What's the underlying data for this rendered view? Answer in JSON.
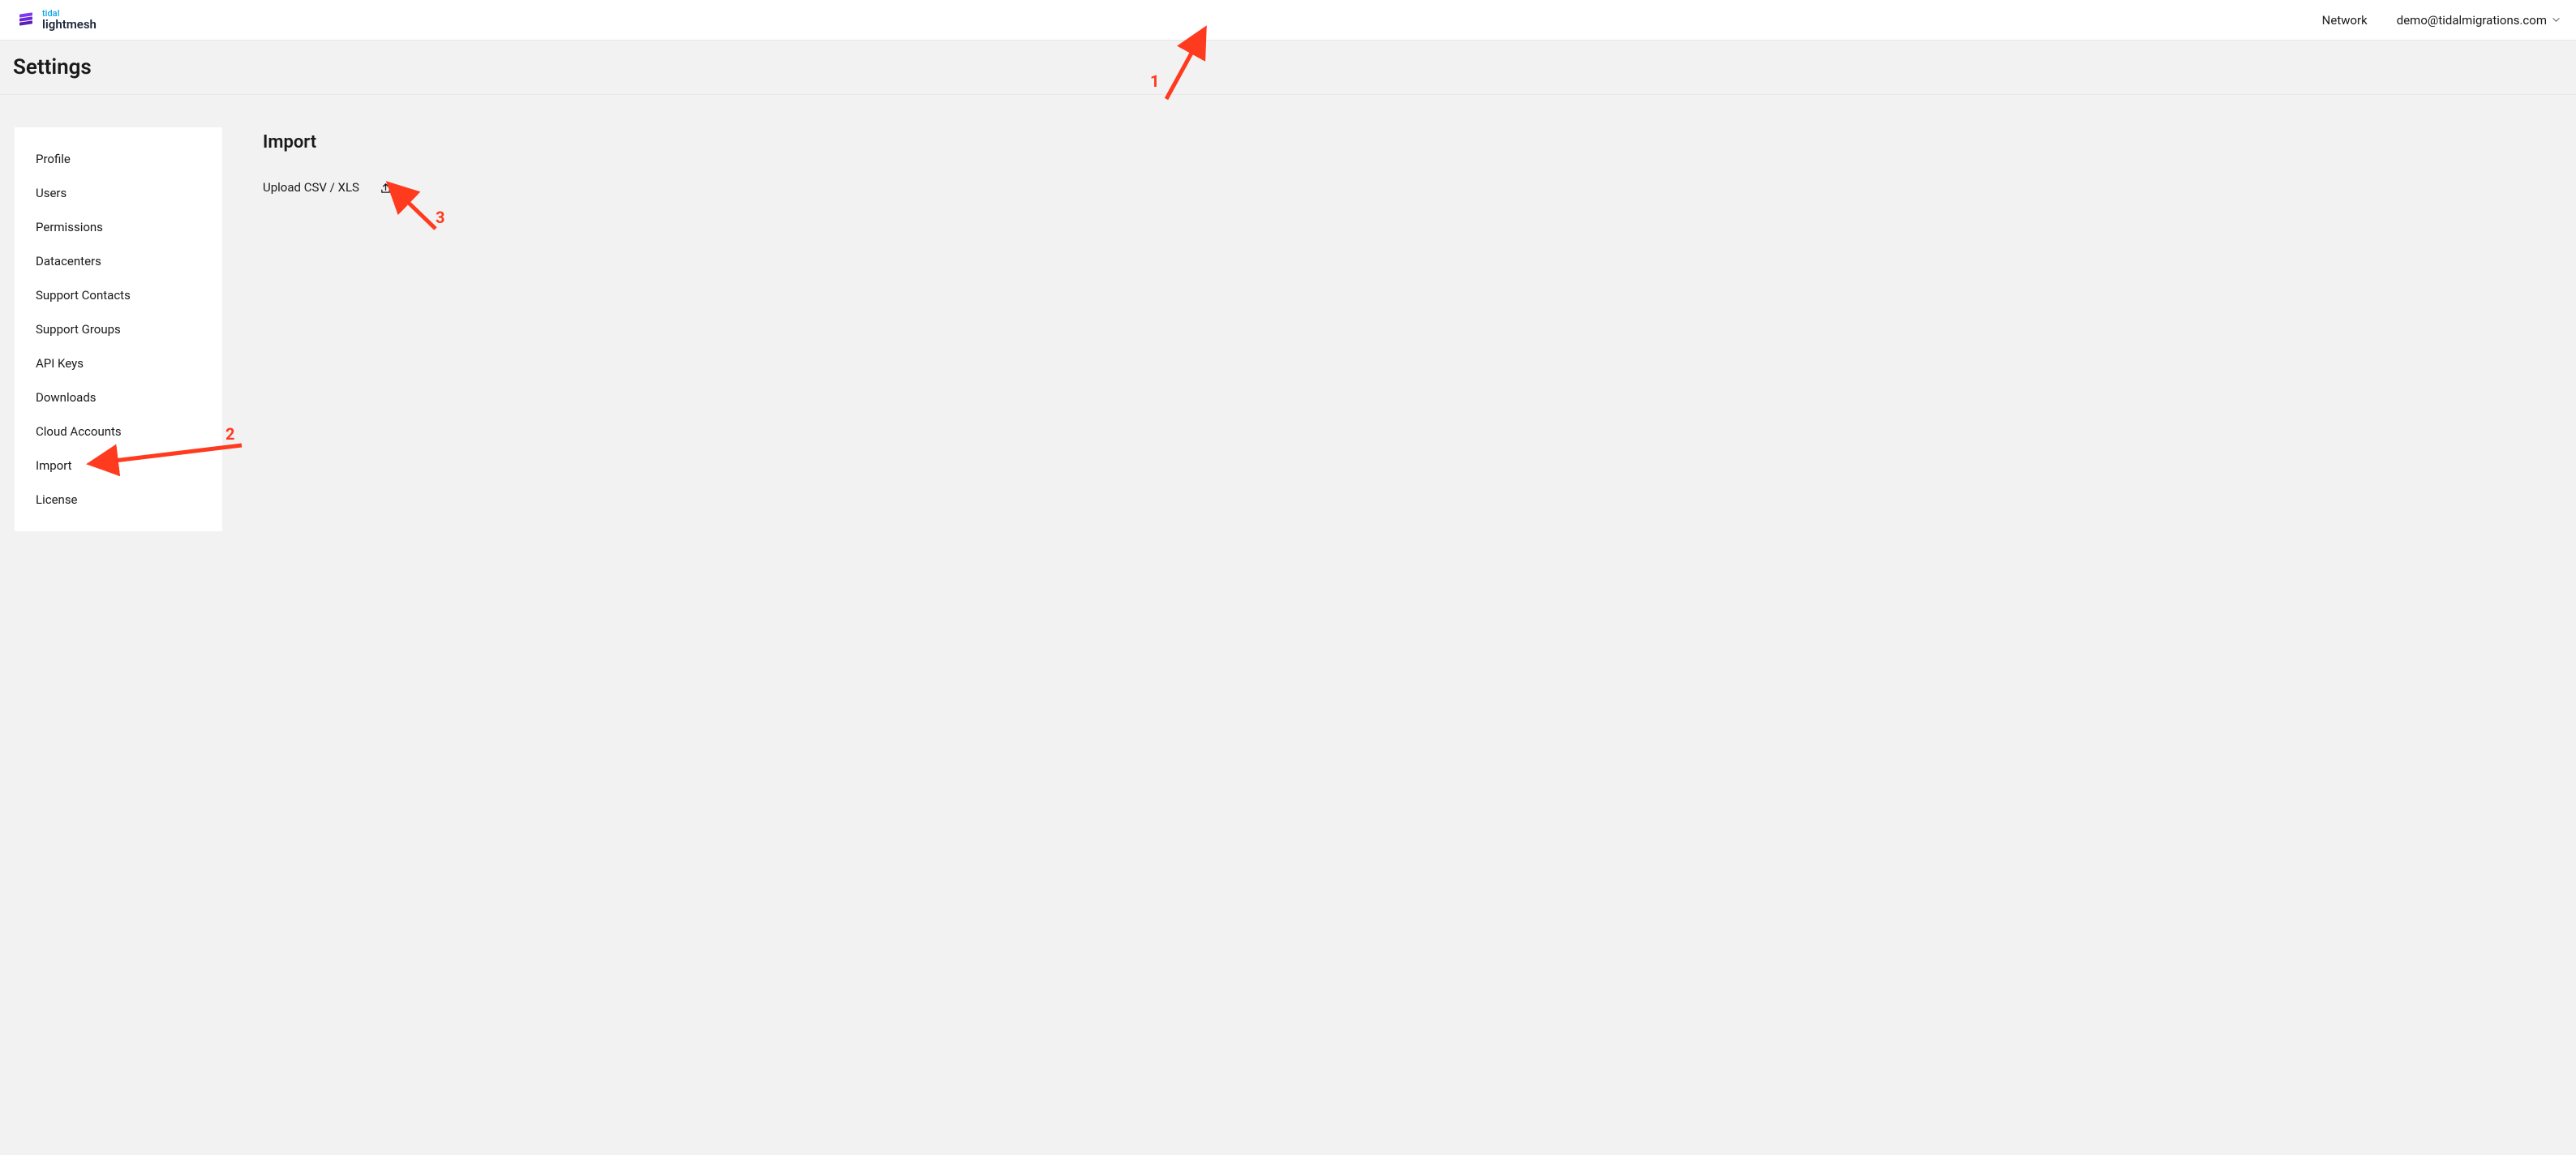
{
  "brand": {
    "top": "tidal",
    "bottom": "lightmesh"
  },
  "topnav": {
    "network": "Network",
    "account": "demo@tidalmigrations.com"
  },
  "page": {
    "title": "Settings"
  },
  "sidebar": {
    "items": [
      {
        "label": "Profile"
      },
      {
        "label": "Users"
      },
      {
        "label": "Permissions"
      },
      {
        "label": "Datacenters"
      },
      {
        "label": "Support Contacts"
      },
      {
        "label": "Support Groups"
      },
      {
        "label": "API Keys"
      },
      {
        "label": "Downloads"
      },
      {
        "label": "Cloud Accounts"
      },
      {
        "label": "Import"
      },
      {
        "label": "License"
      }
    ]
  },
  "main": {
    "heading": "Import",
    "upload_label": "Upload CSV / XLS"
  },
  "annotations": {
    "a1": "1",
    "a2": "2",
    "a3": "3"
  }
}
